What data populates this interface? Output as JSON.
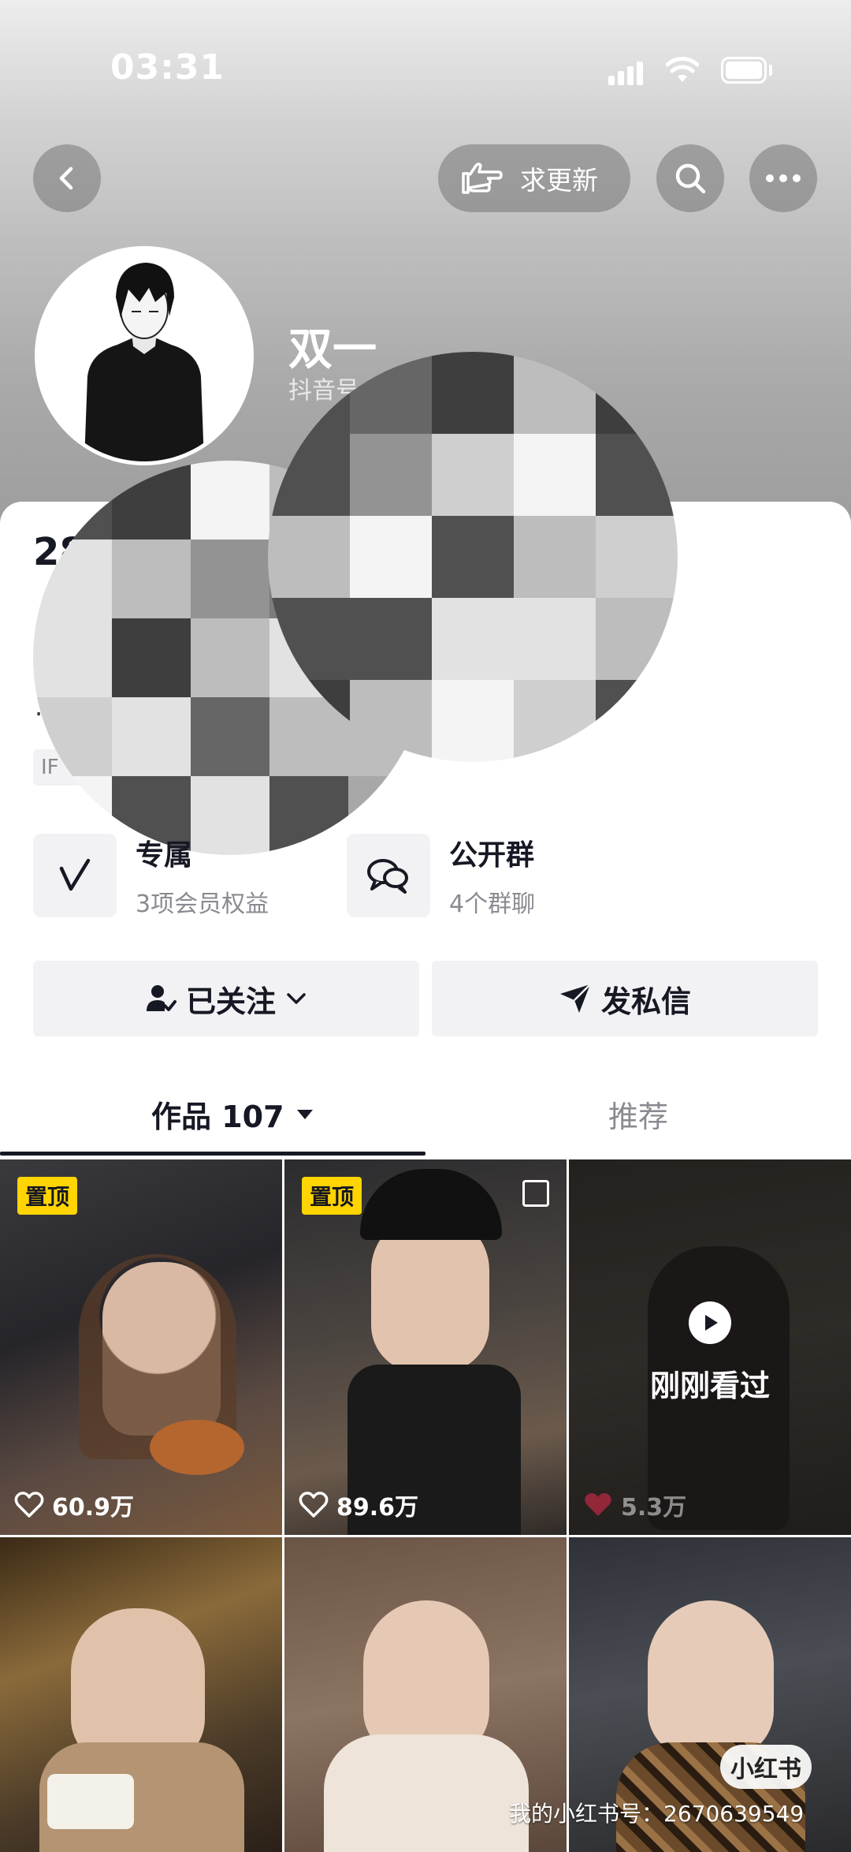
{
  "status_bar": {
    "time": "03:31"
  },
  "header": {
    "update_label": "求更新"
  },
  "profile": {
    "name": "双一",
    "douyin_id_prefix": "抖音号",
    "stat_visible": "28",
    "ip_tag_visible": "IF"
  },
  "features": [
    {
      "title": "专属",
      "subtitle": "3项会员权益"
    },
    {
      "title": "公开群",
      "subtitle": "4个群聊"
    }
  ],
  "actions": {
    "follow_label": "已关注",
    "message_label": "发私信"
  },
  "tabs": [
    {
      "label": "作品 107",
      "active": true
    },
    {
      "label": "推荐",
      "active": false
    }
  ],
  "videos": [
    {
      "pinned": true,
      "pin_label": "置顶",
      "likes": "60.9万"
    },
    {
      "pinned": true,
      "pin_label": "置顶",
      "likes": "89.6万"
    },
    {
      "pinned": false,
      "watched_label": "刚刚看过",
      "likes": "5.3万"
    },
    {
      "pinned": false
    },
    {
      "pinned": false
    },
    {
      "pinned": false
    }
  ],
  "watermark": {
    "badge": "小红书",
    "text": "我的小红书号：2670639549"
  },
  "colors": {
    "pin": "#ffd400",
    "tab_active": "#161823",
    "secondary_text": "#8a8b91",
    "button_bg": "#f2f2f4"
  }
}
